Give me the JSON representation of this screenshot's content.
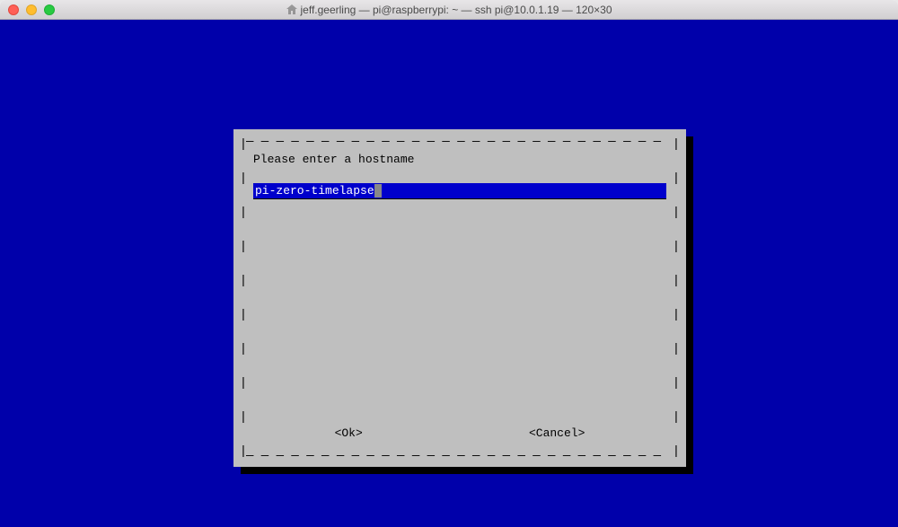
{
  "window": {
    "title": "jeff.geerling — pi@raspberrypi: ~ — ssh pi@10.0.1.19 — 120×30"
  },
  "dialog": {
    "prompt": "Please enter a hostname",
    "input_value": "pi-zero-timelapse",
    "ok_label": "<Ok>",
    "cancel_label": "<Cancel>"
  },
  "border": {
    "pipe": "|",
    "dash_top": "— — — — — — — — — — — — — — — — — — — — — — — — — — — — — — — —",
    "dash_bottom": "— — — — — — — — — — — — — — — — — — — — — — — — — — — — — — — —",
    "corner_tl": "┌",
    "corner_tr": "┐",
    "corner_bl": "└",
    "corner_br": "┘"
  }
}
